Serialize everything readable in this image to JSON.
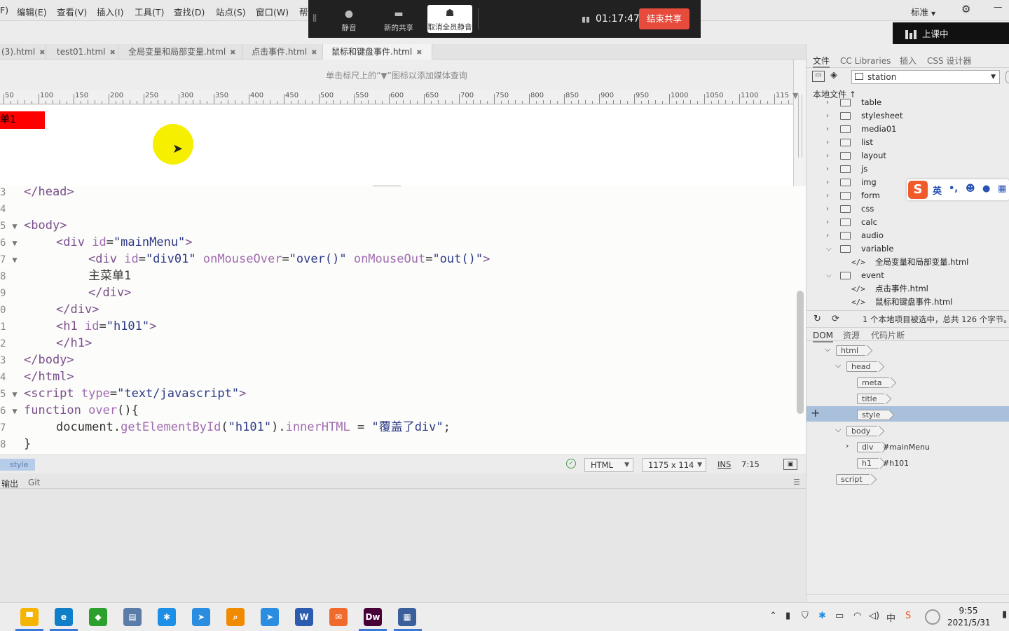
{
  "menubar": {
    "items": [
      "F)",
      "编辑(E)",
      "查看(V)",
      "插入(I)",
      "工具(T)",
      "查找(D)",
      "站点(S)",
      "窗口(W)",
      "帮"
    ],
    "workspace": "标准"
  },
  "share_bar": {
    "mute": "静音",
    "new_share": "新的共享",
    "unmute_all": "取消全员静音",
    "timer": "01:17:47",
    "end_share": "结束共享",
    "live_label": "上课中"
  },
  "tabs": [
    {
      "label": "(3).html",
      "active": false
    },
    {
      "label": "test01.html",
      "active": false
    },
    {
      "label": "全局变量和局部变量.html",
      "active": false
    },
    {
      "label": "点击事件.html",
      "active": false
    },
    {
      "label": "鼠标和键盘事件.html",
      "active": true
    }
  ],
  "media_query_hint": "单击标尺上的“▼”图标以添加媒体查询",
  "ruler_ticks": [
    "50",
    "100",
    "150",
    "200",
    "250",
    "300",
    "350",
    "400",
    "450",
    "500",
    "550",
    "600",
    "650",
    "700",
    "750",
    "800",
    "850",
    "900",
    "950",
    "1000",
    "1050",
    "1100",
    "115"
  ],
  "live_view": {
    "menu_text": "单1"
  },
  "code_lines": [
    {
      "num": "3",
      "fold": "",
      "indent": 0,
      "html": "<span class='tg'>&lt;/head&gt;</span>"
    },
    {
      "num": "4",
      "fold": "",
      "indent": 0,
      "html": ""
    },
    {
      "num": "5",
      "fold": "▼",
      "indent": 0,
      "html": "<span class='tg'>&lt;body&gt;</span>"
    },
    {
      "num": "6",
      "fold": "▼",
      "indent": 1,
      "html": "<span class='tg'>&lt;div</span> <span class='at'>id</span><span class='pl'>=</span><span class='st'>\"mainMenu\"</span><span class='tg'>&gt;</span>"
    },
    {
      "num": "7",
      "fold": "▼",
      "indent": 2,
      "html": "<span class='tg'>&lt;div</span> <span class='at'>id</span><span class='pl'>=</span><span class='st'>\"div01\"</span> <span class='fn'>onMouseOver</span><span class='pl'>=</span><span class='st'>\"over()\"</span> <span class='fn'>onMouseOut</span><span class='pl'>=</span><span class='st'>\"out()\"</span><span class='tg'>&gt;</span>"
    },
    {
      "num": "8",
      "fold": "",
      "indent": 2,
      "html": "<span class='pl'>主菜单1</span>"
    },
    {
      "num": "9",
      "fold": "",
      "indent": 2,
      "html": "<span class='tg'>&lt;/div&gt;</span>"
    },
    {
      "num": "0",
      "fold": "",
      "indent": 1,
      "html": "<span class='tg'>&lt;/div&gt;</span>"
    },
    {
      "num": "1",
      "fold": "",
      "indent": 1,
      "html": "<span class='tg'>&lt;h1</span> <span class='at'>id</span><span class='pl'>=</span><span class='st'>\"h101\"</span><span class='tg'>&gt;</span>"
    },
    {
      "num": "2",
      "fold": "",
      "indent": 1,
      "html": "<span class='tg'>&lt;/h1&gt;</span>"
    },
    {
      "num": "3",
      "fold": "",
      "indent": 0,
      "html": "<span class='tg'>&lt;/body&gt;</span>"
    },
    {
      "num": "4",
      "fold": "",
      "indent": 0,
      "html": "<span class='tg'>&lt;/html&gt;</span>"
    },
    {
      "num": "5",
      "fold": "▼",
      "indent": 0,
      "html": "<span class='tg'>&lt;script</span> <span class='at'>type</span><span class='pl'>=</span><span class='st'>\"text/javascript\"</span><span class='tg'>&gt;</span>"
    },
    {
      "num": "6",
      "fold": "▼",
      "indent": 0,
      "html": "<span class='kw'>function</span> <span class='fn'>over</span><span class='pl'>(){</span>"
    },
    {
      "num": "7",
      "fold": "",
      "indent": 1,
      "html": "<span class='pl'>document.</span><span class='mt'>getElementById</span><span class='pl'>(</span><span class='st'>\"h101\"</span><span class='pl'>).</span><span class='mt'>innerHTML</span> <span class='pl'>=</span> <span class='st'>\"覆盖了div\"</span><span class='pl'>;</span>"
    },
    {
      "num": "8",
      "fold": "",
      "indent": 0,
      "html": "<span class='pl'>}</span>"
    }
  ],
  "status": {
    "tag": "style",
    "doc_type": "HTML",
    "size": "1175 x 114",
    "mode": "INS",
    "position": "7:15"
  },
  "output_panel": {
    "tabs": [
      "输出",
      "Git"
    ]
  },
  "files_panel": {
    "tabs": [
      "文件",
      "CC Libraries",
      "插入",
      "CSS 设计器"
    ],
    "site": "station",
    "local_files_label": "本地文件",
    "tree": [
      {
        "type": "folder",
        "label": "table",
        "open": false,
        "level": 0
      },
      {
        "type": "folder",
        "label": "stylesheet",
        "open": false,
        "level": 0
      },
      {
        "type": "folder",
        "label": "media01",
        "open": false,
        "level": 0
      },
      {
        "type": "folder",
        "label": "list",
        "open": false,
        "level": 0
      },
      {
        "type": "folder",
        "label": "layout",
        "open": false,
        "level": 0
      },
      {
        "type": "folder",
        "label": "js",
        "open": false,
        "level": 0
      },
      {
        "type": "folder",
        "label": "img",
        "open": false,
        "level": 0
      },
      {
        "type": "folder",
        "label": "form",
        "open": false,
        "level": 0
      },
      {
        "type": "folder",
        "label": "css",
        "open": false,
        "level": 0
      },
      {
        "type": "folder",
        "label": "calc",
        "open": false,
        "level": 0
      },
      {
        "type": "folder",
        "label": "audio",
        "open": false,
        "level": 0
      },
      {
        "type": "folder",
        "label": "variable",
        "open": true,
        "level": 0
      },
      {
        "type": "file",
        "label": "全局变量和局部变量.html",
        "level": 1
      },
      {
        "type": "folder",
        "label": "event",
        "open": true,
        "level": 0
      },
      {
        "type": "file",
        "label": "点击事件.html",
        "level": 1
      },
      {
        "type": "file",
        "label": "鼠标和键盘事件.html",
        "level": 1
      }
    ],
    "status_text": "1 个本地项目被选中，总共 126 个字节。"
  },
  "dom_panel": {
    "tabs": [
      "DOM",
      "资源",
      "代码片断"
    ],
    "nodes": [
      {
        "tag": "html",
        "depth": 0,
        "expander": "⌵",
        "label": ""
      },
      {
        "tag": "head",
        "depth": 1,
        "expander": "⌵",
        "label": ""
      },
      {
        "tag": "meta",
        "depth": 2,
        "expander": "",
        "label": ""
      },
      {
        "tag": "title",
        "depth": 2,
        "expander": "",
        "label": ""
      },
      {
        "tag": "style",
        "depth": 2,
        "expander": "",
        "label": "",
        "selected": true
      },
      {
        "tag": "body",
        "depth": 1,
        "expander": "⌵",
        "label": ""
      },
      {
        "tag": "div",
        "depth": 2,
        "expander": "›",
        "label": "#mainMenu"
      },
      {
        "tag": "h1",
        "depth": 2,
        "expander": "",
        "label": "#h101"
      },
      {
        "tag": "script",
        "depth": 0,
        "expander": "",
        "label": ""
      }
    ]
  },
  "ime": {
    "lang": "英",
    "punct": "•,",
    "emoji": "☻",
    "mic": "🎤",
    "grid": "▦"
  },
  "taskbar": {
    "apps": [
      {
        "name": "file-explorer-icon",
        "glyph": "▀",
        "color": "#f4b400"
      },
      {
        "name": "edge-icon",
        "glyph": "e",
        "color": "#0f7fc9"
      },
      {
        "name": "app-icon-3",
        "glyph": "◆",
        "color": "#2ca02c"
      },
      {
        "name": "app-icon-4",
        "glyph": "▤",
        "color": "#5b7ca8"
      },
      {
        "name": "app-icon-5",
        "glyph": "✱",
        "color": "#1e8fe6"
      },
      {
        "name": "app-icon-6",
        "glyph": "➤",
        "color": "#2a8de0"
      },
      {
        "name": "search-app-icon",
        "glyph": "⌕",
        "color": "#f08a00"
      },
      {
        "name": "app-icon-8",
        "glyph": "➤",
        "color": "#2a8de0"
      },
      {
        "name": "word-icon",
        "glyph": "W",
        "color": "#2b5cb0"
      },
      {
        "name": "app-icon-10",
        "glyph": "✉",
        "color": "#f06a2c"
      },
      {
        "name": "dreamweaver-icon",
        "glyph": "Dw",
        "color": "#470137"
      },
      {
        "name": "app-icon-12",
        "glyph": "▦",
        "color": "#3b5f9a"
      }
    ],
    "tray_ime": "中",
    "time": "9:55",
    "date": "2021/5/31"
  }
}
